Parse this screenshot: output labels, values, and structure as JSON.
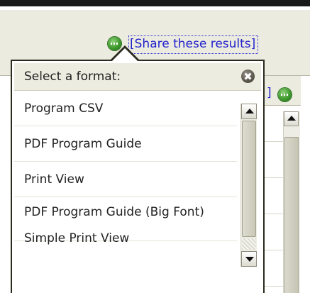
{
  "share": {
    "link_label": "[Share these results]",
    "icon": "green-dot-icon"
  },
  "background": {
    "bracket": "]",
    "icon": "green-dot-icon"
  },
  "popup": {
    "title": "Select a format:",
    "close_icon": "close-icon",
    "items": [
      {
        "label": "Program CSV"
      },
      {
        "label": "PDF Program Guide"
      },
      {
        "label": "Print View"
      },
      {
        "label": "PDF Program Guide (Big Font)"
      },
      {
        "label": "Simple Print View"
      }
    ]
  },
  "colors": {
    "link": "#2222cc",
    "header_bg": "#ecebe0",
    "border": "#2a2a1e",
    "icon_green": "#3f9a2e"
  }
}
